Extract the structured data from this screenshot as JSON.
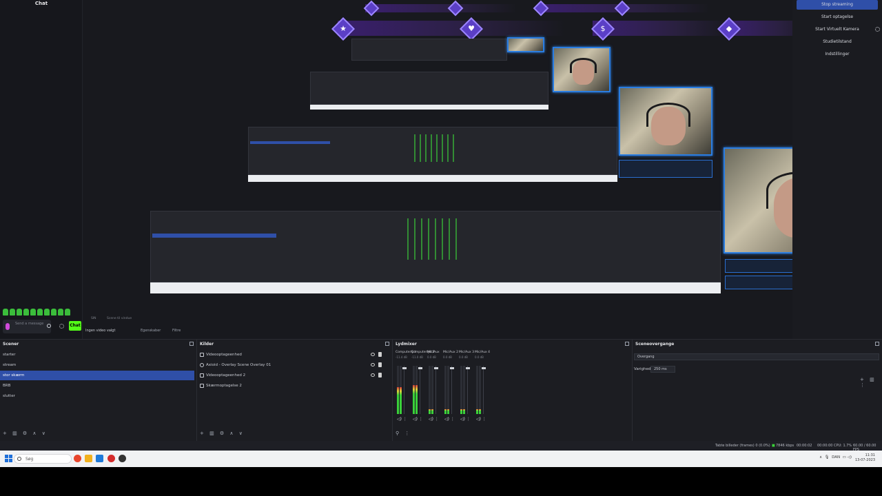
{
  "chat": {
    "title": "Chat",
    "input_placeholder": "Send a message",
    "send_label": "Chat",
    "no_video_label": "Ingen video valgt",
    "toolbar_label_1": "Egenskaber",
    "toolbar_label_2": "Filtre",
    "small_caption_1": "SIN",
    "small_caption_2": "Scene til vindue"
  },
  "controls": {
    "items": [
      {
        "label": "Stop streaming"
      },
      {
        "label": "Start optagelse"
      },
      {
        "label": "Start Virtuelt Kamera"
      },
      {
        "label": "Studietilstand"
      },
      {
        "label": "Indstillinger"
      }
    ],
    "accent": "#2f4fa8"
  },
  "docks": {
    "scenes": {
      "title": "Scener",
      "items": [
        {
          "label": "starter"
        },
        {
          "label": "stream"
        },
        {
          "label": "stor skærm"
        },
        {
          "label": "BRB"
        },
        {
          "label": "slutter"
        }
      ]
    },
    "sources": {
      "title": "Kilder",
      "items": [
        {
          "label": "Videooptageenhed"
        },
        {
          "label": "Axioid - Overlay Scene Overlay 01"
        },
        {
          "label": "Videooptageenhed 2"
        },
        {
          "label": "Skærmoptagelse 2"
        }
      ]
    },
    "mixer": {
      "title": "Lydmixer",
      "channels": [
        {
          "name": "Computerlyd",
          "db": "-11.4 dB",
          "level": 0.55
        },
        {
          "name": "Computerlyd 2",
          "db": "-11.0 dB",
          "level": 0.6
        },
        {
          "name": "Mic/Aux",
          "db": "0.0 dB",
          "level": 0.1
        },
        {
          "name": "Mic/Aux 2",
          "db": "0.0 dB",
          "level": 0.1
        },
        {
          "name": "Mic/Aux 3",
          "db": "0.0 dB",
          "level": 0.1
        },
        {
          "name": "Mic/Aux 4",
          "db": "0.0 dB",
          "level": 0.1
        }
      ]
    },
    "transitions": {
      "title": "Sceneovergange",
      "transition_value": "Overgang",
      "duration_label": "Varighed",
      "duration_value": "250 ms"
    }
  },
  "status": {
    "dropped": "Tabte billeder (frames) 0 (0.0%)",
    "bitrate": "7846 kbps",
    "live": "00:00:02",
    "rec": "00:00:00",
    "cpu": "CPU: 1.7%",
    "fps": "60.00 / 60.00 FPS"
  },
  "taskbar": {
    "search_placeholder": "Søg",
    "lang": "DAN",
    "time": "11:31",
    "date": "13-07-2023"
  }
}
